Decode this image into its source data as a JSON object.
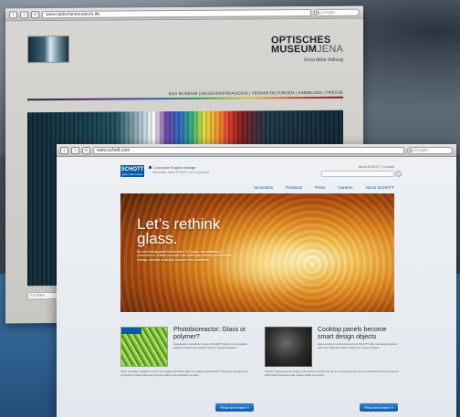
{
  "window_museum": {
    "url": "www.optischesmuseum.de",
    "search_placeholder": "Google",
    "title_line1": "OPTISCHES",
    "title_line2_bold": "MUSEUM",
    "title_line2_thin": "JENA",
    "subtitle": "Ernst Abbe Stiftung",
    "nav": "DAS MUSEUM | MUSEUMSPÄDAGOGIK | VERANSTALTUNGEN | SAMMLUNG | PRESSE",
    "search_box": "suchen..."
  },
  "window_schott": {
    "url": "www.schott.com",
    "search_placeholder": "Google",
    "logo": "SCHOTT",
    "logo_tagline": "glass made of ideas",
    "corporate_label": "Corporate",
    "corporate_english": "English",
    "corporate_lang": "change",
    "corporate_note": "Information about SCHOTT and its products",
    "top_links": "About SCHOTT | Contact",
    "nav": [
      "Innovation",
      "Products",
      "Press",
      "Careers",
      "About SCHOTT"
    ],
    "hero_headline_line1": "Let’s rethink",
    "hero_headline_line2": "glass.",
    "hero_body": "By reinventing glass for the past 130 years, we enable our customers to create products that challenge existing conventions, change markets or simply improve their business.",
    "articles": [
      {
        "title": "Photobioreactor: Glass or polymer?",
        "text": "Sustainable productivity, made of SCHOTT tubing. A comparative analysis of glass and polymer tubes in photobioreactors.",
        "text_wide": "which material is suitable to grow micro-algae and which offers the highest productivity? This study compares the properties of glass tubes and polymer tubes in the cultivation process.",
        "read_more": "Read and learn! »"
      },
      {
        "title": "Cooktop panels become smart design objects",
        "text": "Glass-ceramic cooktop panels from SCHOTT offer new design options with color, light and surface effects for modern kitchens.",
        "text_wide": "SCHOTT glass-ceramic design is the answer to these trends. It is transparent and can be printed and lit from below so that product designers can create entirely new looks.",
        "read_more": "Read and learn! »"
      }
    ]
  }
}
